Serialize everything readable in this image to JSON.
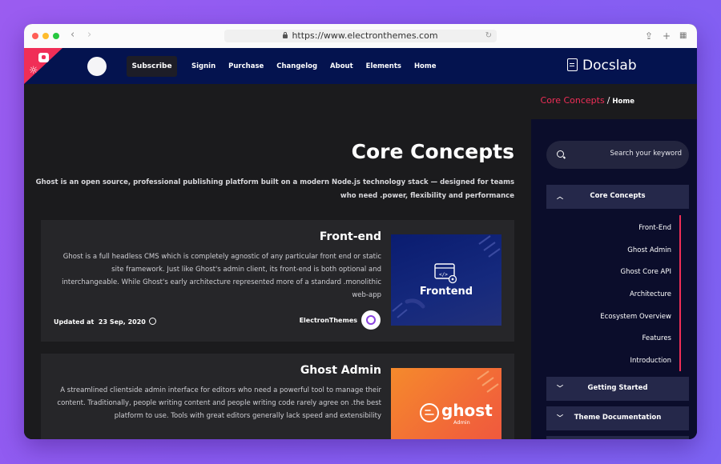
{
  "browser": {
    "url": "https://www.electronthemes.com"
  },
  "header": {
    "subscribe_label": "Subscribe",
    "menu": [
      "Signin",
      "Purchase",
      "Changelog",
      "About",
      "Elements",
      "Home"
    ],
    "brand": "Docslab"
  },
  "breadcrumb": {
    "current": "Core Concepts",
    "separator": "/",
    "home": "Home"
  },
  "main": {
    "title": "Core Concepts",
    "intro": "Ghost is an open source, professional publishing platform built on a modern Node.js technology stack — designed for teams who need .power, flexibility and performance",
    "cards": [
      {
        "title": "Front-end",
        "body": "Ghost is a full headless CMS which is completely agnostic of any particular front end or static site framework. Just like Ghost's admin client, its front-end is both optional and interchangeable. While Ghost's early architecture represented more of a standard .monolithic web-app",
        "updated_label": "Updated at",
        "updated_date": "23 Sep, 2020",
        "author": "ElectronThemes",
        "thumb_label": "Frontend"
      },
      {
        "title": "Ghost Admin",
        "body": "A streamlined clientside admin interface for editors who need a powerful tool to manage their content. Traditionally, people writing content and people writing code rarely agree on .the best platform to use. Tools with great editors generally lack speed and extensibility",
        "thumb_label": "ghost",
        "thumb_sublabel": "Admin"
      }
    ]
  },
  "sidebar": {
    "search_placeholder": "Search your keyword",
    "sections": [
      {
        "label": "Core Concepts",
        "expanded": true
      },
      {
        "label": "Getting Started",
        "expanded": false
      },
      {
        "label": "Theme Documentation",
        "expanded": false
      }
    ],
    "items": [
      "Front-End",
      "Ghost Admin",
      "Ghost Core API",
      "Architecture",
      "Ecosystem Overview",
      "Features",
      "Introduction"
    ]
  },
  "colors": {
    "accent": "#f02e57",
    "header_bg": "#04134f",
    "sidebar_bg": "#0b0d2b",
    "main_bg": "#1b1b1d",
    "card_bg": "#262629"
  }
}
